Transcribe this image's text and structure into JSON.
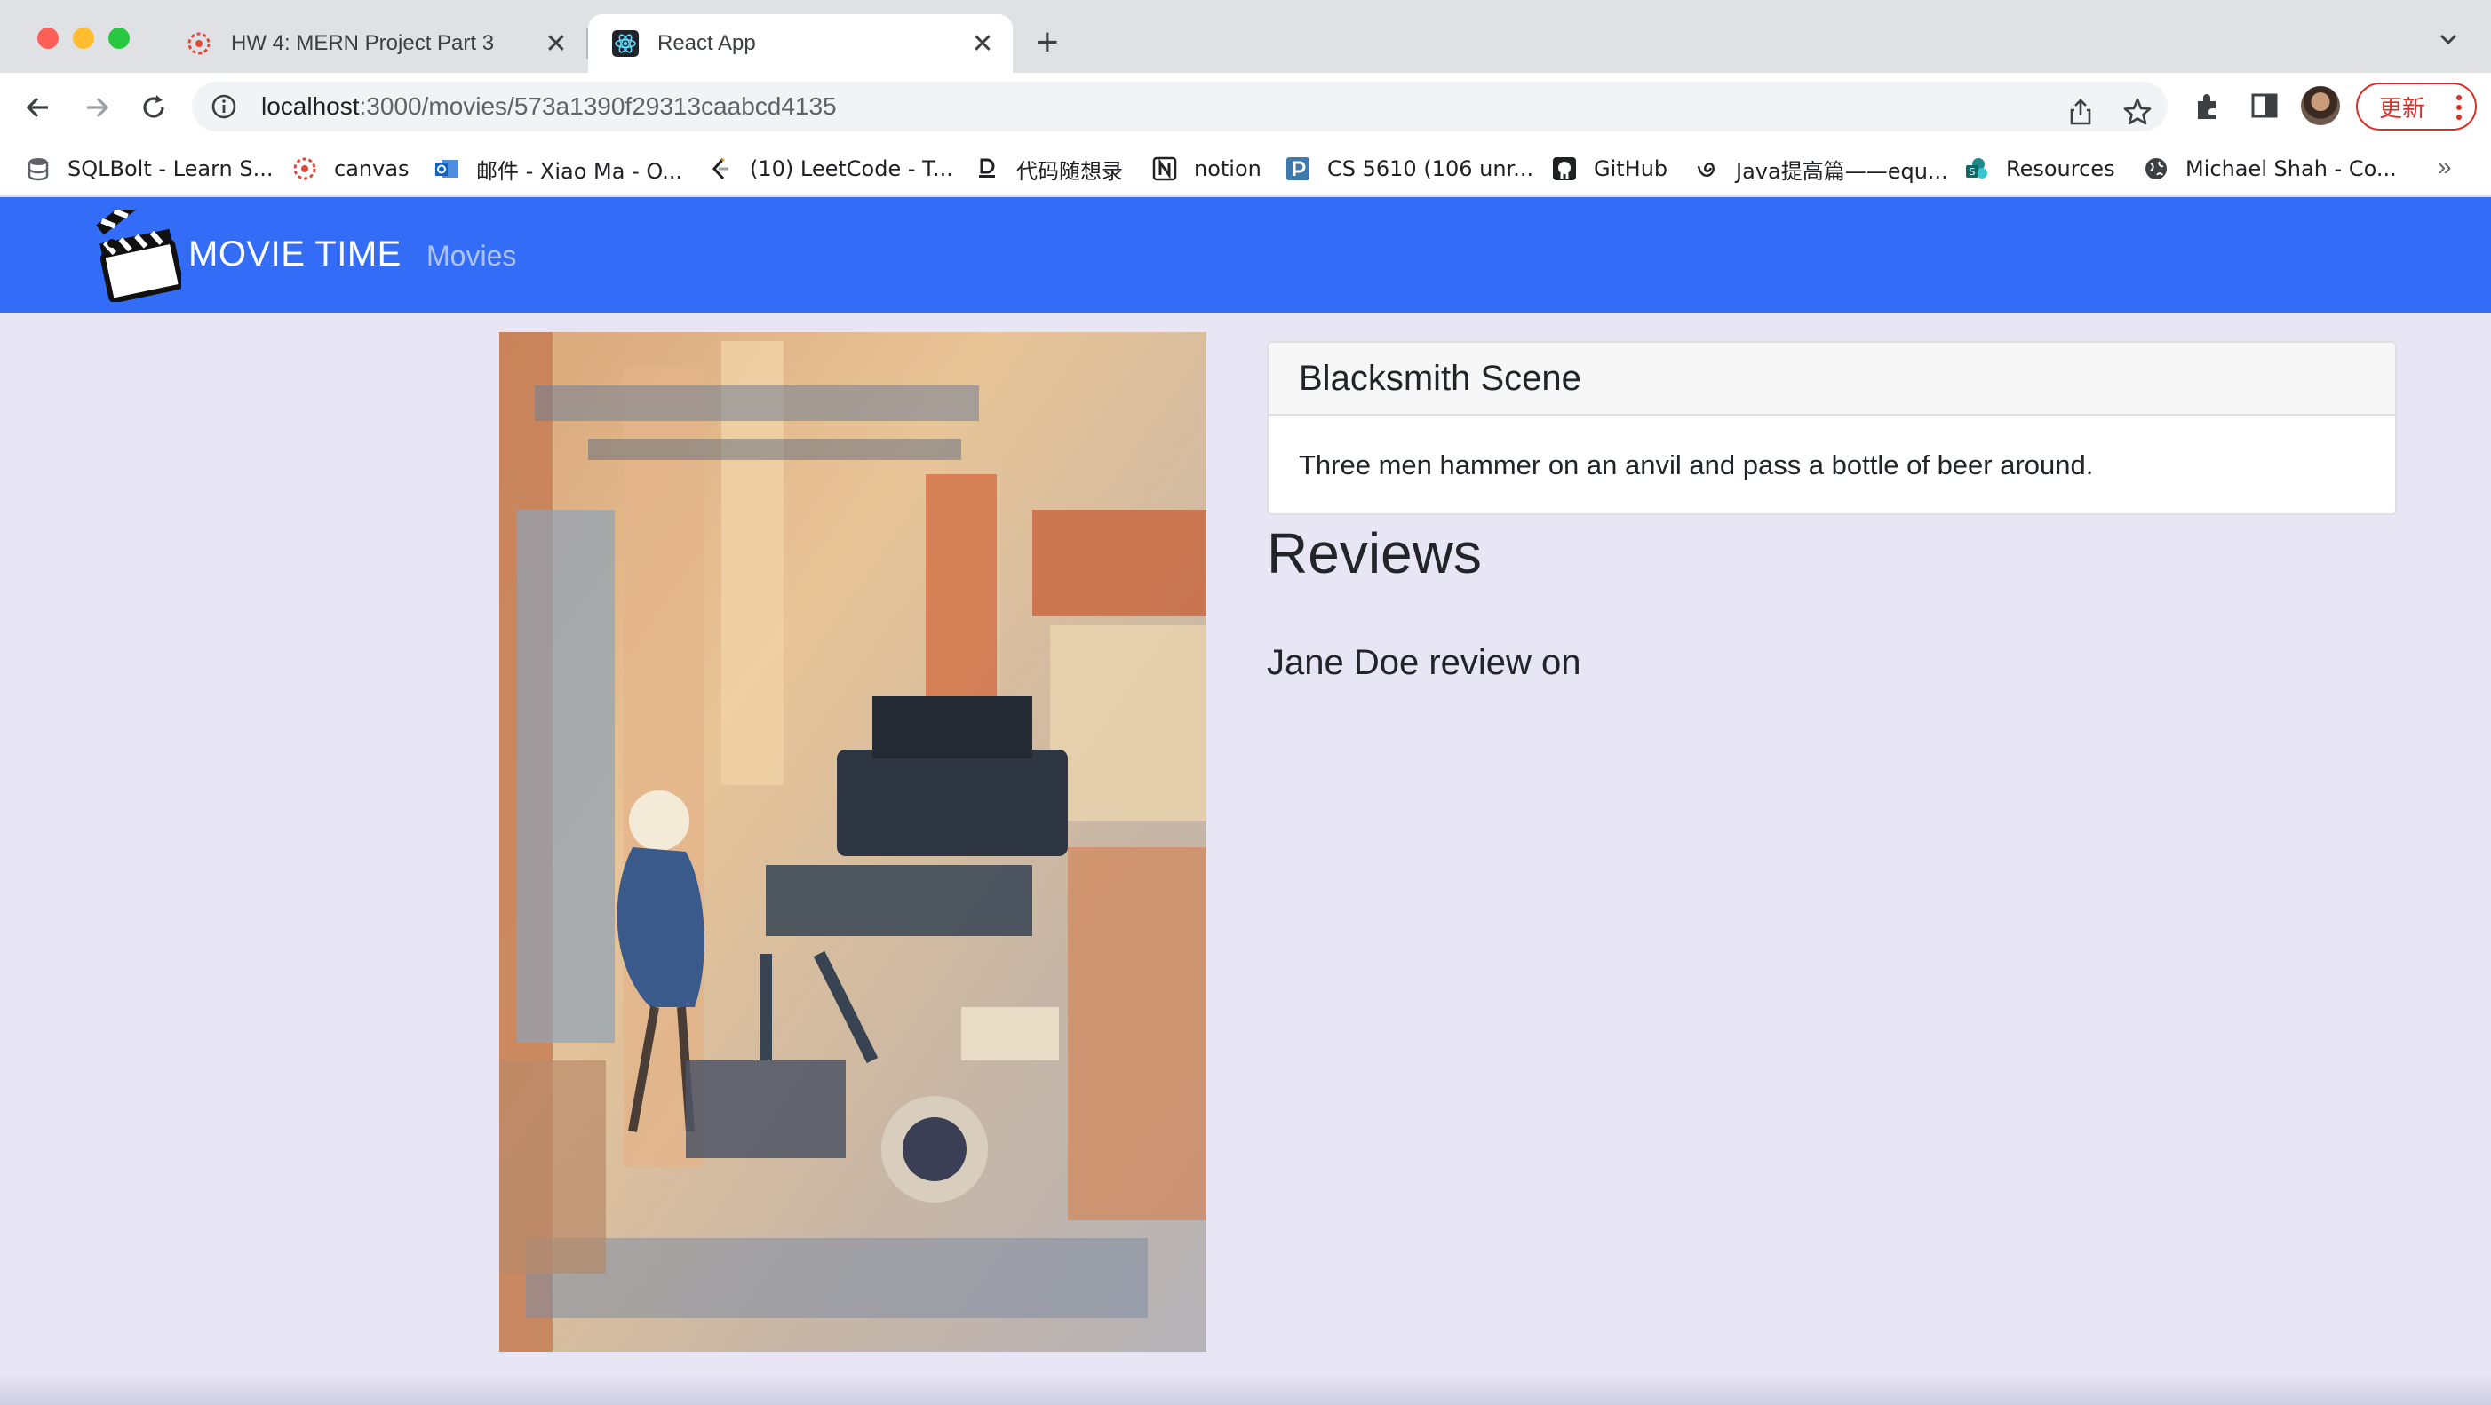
{
  "browser": {
    "tabs": [
      {
        "title": "HW 4: MERN Project Part 3",
        "favicon": "canvas-icon",
        "active": false
      },
      {
        "title": "React App",
        "favicon": "react-icon",
        "active": true
      }
    ],
    "url_host": "localhost",
    "url_path": ":3000/movies/573a1390f29313caabcd4135",
    "update_label": "更新",
    "bookmarks": [
      {
        "label": "SQLBolt - Learn S...",
        "icon": "database-icon"
      },
      {
        "label": "canvas",
        "icon": "canvas-icon"
      },
      {
        "label": "邮件 - Xiao Ma - O...",
        "icon": "outlook-icon"
      },
      {
        "label": "(10) LeetCode - T...",
        "icon": "leetcode-icon"
      },
      {
        "label": "代码随想录",
        "icon": "code-icon"
      },
      {
        "label": "notion",
        "icon": "notion-icon"
      },
      {
        "label": "CS 5610 (106 unr...",
        "icon": "piazza-icon"
      },
      {
        "label": "GitHub",
        "icon": "github-icon"
      },
      {
        "label": "Java提高篇——equ...",
        "icon": "java-icon"
      },
      {
        "label": "Resources",
        "icon": "sharepoint-icon"
      },
      {
        "label": "Michael Shah - Co...",
        "icon": "globe-icon"
      }
    ],
    "bookmarks_more": "»"
  },
  "app": {
    "brand": "MOVIE TIME",
    "nav_movies": "Movies",
    "movie": {
      "title": "Blacksmith Scene",
      "plot": "Three men hammer on an anvil and pass a bottle of beer around."
    },
    "reviews_heading": "Reviews",
    "review": "Jane Doe review on"
  },
  "colors": {
    "navbar": "#336cf6",
    "page_bg": "#e8e6f5",
    "update_red": "#d93025"
  }
}
